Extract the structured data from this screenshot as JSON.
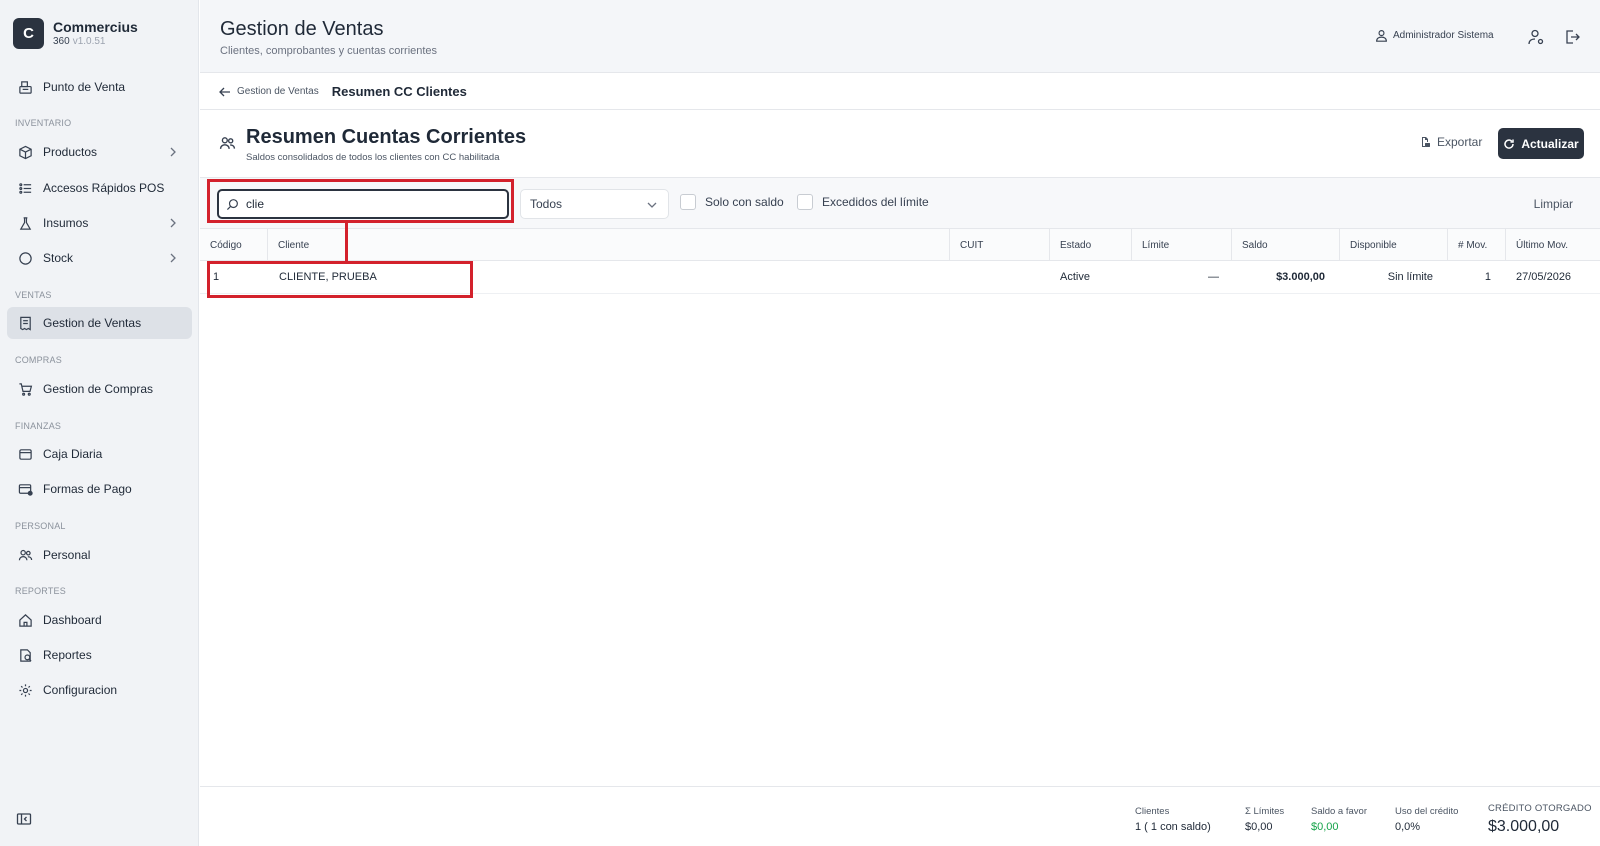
{
  "brand": {
    "letter": "C",
    "name": "Commercius",
    "product": "360",
    "version": "v1.0.51"
  },
  "sidebar": {
    "items": [
      {
        "label": "Punto de Venta"
      },
      {
        "label": "INVENTARIO"
      },
      {
        "label": "Productos"
      },
      {
        "label": "Accesos Rápidos POS"
      },
      {
        "label": "Insumos"
      },
      {
        "label": "Stock"
      },
      {
        "label": "VENTAS"
      },
      {
        "label": "Gestion de Ventas"
      },
      {
        "label": "COMPRAS"
      },
      {
        "label": "Gestion de Compras"
      },
      {
        "label": "FINANZAS"
      },
      {
        "label": "Caja Diaria"
      },
      {
        "label": "Formas de Pago"
      },
      {
        "label": "PERSONAL"
      },
      {
        "label": "Personal"
      },
      {
        "label": "REPORTES"
      },
      {
        "label": "Dashboard"
      },
      {
        "label": "Reportes"
      },
      {
        "label": "Configuracion"
      }
    ]
  },
  "header": {
    "title": "Gestion de Ventas",
    "subtitle": "Clientes, comprobantes y cuentas corrientes",
    "user": "Administrador Sistema"
  },
  "breadcrumb": {
    "back": "Gestion de Ventas",
    "current": "Resumen CC Clientes"
  },
  "page": {
    "title": "Resumen Cuentas Corrientes",
    "subtitle": "Saldos consolidados de todos los clientes con CC habilitada",
    "export_label": "Exportar",
    "update_label": "Actualizar"
  },
  "filters": {
    "search_value": "clie",
    "select_value": "Todos",
    "only_balance": "Solo con saldo",
    "exceeded": "Excedidos del límite",
    "clear": "Limpiar"
  },
  "table": {
    "columns": [
      "Código",
      "Cliente",
      "CUIT",
      "Estado",
      "Límite",
      "Saldo",
      "Disponible",
      "# Mov.",
      "Último Mov."
    ],
    "rows": [
      {
        "codigo": "1",
        "cliente": "CLIENTE, PRUEBA",
        "cuit": "",
        "estado": "Active",
        "limite": "—",
        "saldo": "$3.000,00",
        "disponible": "Sin límite",
        "mov": "1",
        "ultimo": "27/05/2026"
      }
    ]
  },
  "footer": {
    "clientes_label": "Clientes",
    "clientes_value": "1 ( 1  con saldo)",
    "limites_label": "Σ Límites",
    "limites_value": "$0,00",
    "favor_label": "Saldo a favor",
    "favor_value": "$0,00",
    "uso_label": "Uso del crédito",
    "uso_value": "0,0%",
    "credito_label": "CRÉDITO OTORGADO",
    "credito_value": "$3.000,00"
  },
  "colors": {
    "accent": "#2b3340",
    "highlight": "#d3212c",
    "positive": "#16a34a",
    "sidebar_bg": "#f1f3f6"
  }
}
